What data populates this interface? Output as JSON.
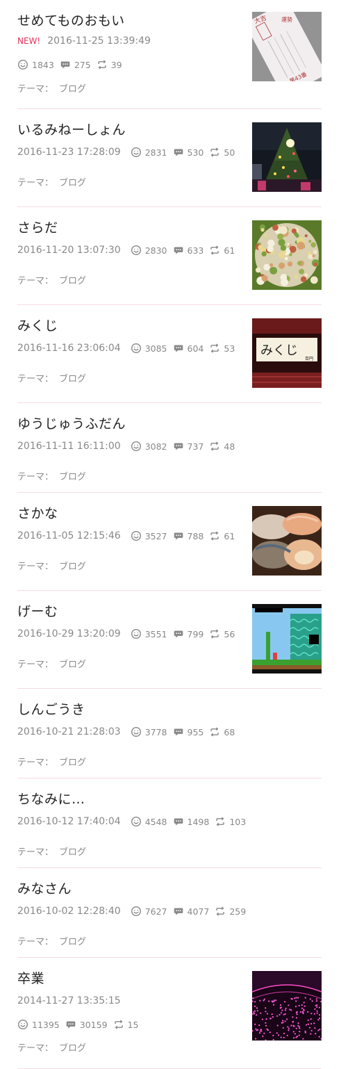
{
  "theme_label": "テーマ：",
  "entries": [
    {
      "title": "せめてものおもい",
      "new_badge": "NEW!",
      "date": "2016-11-25 13:39:49",
      "smiles": "1843",
      "comments": "275",
      "reblogs": "39",
      "theme": "ブログ",
      "thumb": "fortune-slip-photo",
      "thumb_text": [
        "大吉",
        "運勢",
        "第43番"
      ]
    },
    {
      "title": "いるみねーしょん",
      "date": "2016-11-23 17:28:09",
      "smiles": "2831",
      "comments": "530",
      "reblogs": "50",
      "theme": "ブログ",
      "thumb": "christmas-tree-photo"
    },
    {
      "title": "さらだ",
      "date": "2016-11-20 13:07:30",
      "smiles": "2830",
      "comments": "633",
      "reblogs": "61",
      "theme": "ブログ",
      "thumb": "salad-photo"
    },
    {
      "title": "みくじ",
      "date": "2016-11-16 23:06:04",
      "smiles": "3085",
      "comments": "604",
      "reblogs": "53",
      "theme": "ブログ",
      "thumb": "mikuji-sign-photo",
      "thumb_text": [
        "みくじ",
        "百円"
      ]
    },
    {
      "title": "ゆうじゅうふだん",
      "date": "2016-11-11 16:11:00",
      "smiles": "3082",
      "comments": "737",
      "reblogs": "48",
      "theme": "ブログ"
    },
    {
      "title": "さかな",
      "date": "2016-11-05 12:15:46",
      "smiles": "3527",
      "comments": "788",
      "reblogs": "61",
      "theme": "ブログ",
      "thumb": "sushi-photo"
    },
    {
      "title": "げーむ",
      "date": "2016-10-29 13:20:09",
      "smiles": "3551",
      "comments": "799",
      "reblogs": "56",
      "theme": "ブログ",
      "thumb": "game-screen-photo"
    },
    {
      "title": "しんごうき",
      "date": "2016-10-21 21:28:03",
      "smiles": "3778",
      "comments": "955",
      "reblogs": "68",
      "theme": "ブログ"
    },
    {
      "title": "ちなみに…",
      "date": "2016-10-12 17:40:04",
      "smiles": "4548",
      "comments": "1498",
      "reblogs": "103",
      "theme": "ブログ"
    },
    {
      "title": "みなさん",
      "date": "2016-10-02 12:28:40",
      "smiles": "7627",
      "comments": "4077",
      "reblogs": "259",
      "theme": "ブログ"
    },
    {
      "title": "卒業",
      "date": "2014-11-27 13:35:15",
      "smiles": "11395",
      "comments": "30159",
      "reblogs": "15",
      "theme": "ブログ",
      "thumb": "concert-penlight-photo"
    }
  ],
  "icons": {
    "smile": "smile-icon",
    "comment": "comment-icon",
    "reblog": "reblog-icon"
  },
  "colors": {
    "new_badge": "#e0315a",
    "divider": "#f6dbe4",
    "meta_text": "#888888",
    "title_text": "#222222"
  }
}
